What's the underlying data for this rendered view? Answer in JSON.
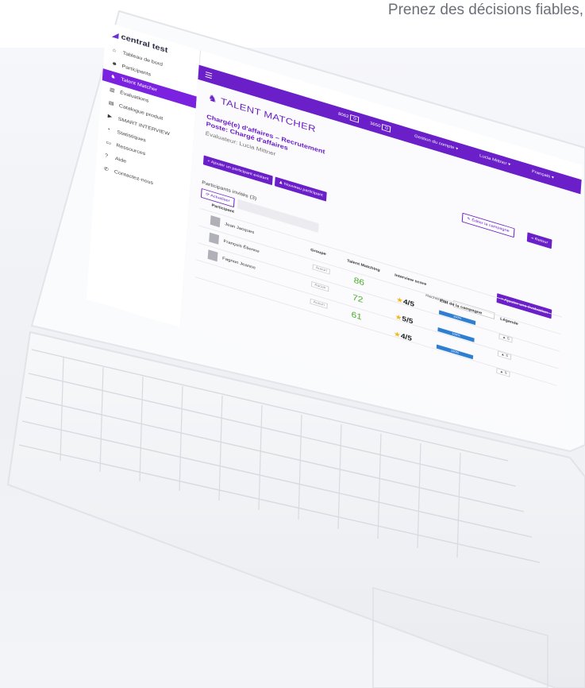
{
  "tagline": "Prenez des décisions fiables,",
  "sidebar": {
    "logo": "central test",
    "items": [
      {
        "icon": "dashboard-icon",
        "glyph": "⌂",
        "label": "Tableau de bord"
      },
      {
        "icon": "users-icon",
        "glyph": "☻",
        "label": "Participants"
      },
      {
        "icon": "talent-icon",
        "glyph": "♞",
        "label": "Talent Matcher"
      },
      {
        "icon": "chart-icon",
        "glyph": "▥",
        "label": "Évaluations"
      },
      {
        "icon": "book-icon",
        "glyph": "▤",
        "label": "Catalogue produit"
      },
      {
        "icon": "video-icon",
        "glyph": "▶",
        "label": "SMART INTERVIEW"
      },
      {
        "icon": "pie-icon",
        "glyph": "◔",
        "label": "Statistiques"
      },
      {
        "icon": "file-icon",
        "glyph": "▭",
        "label": "Ressources"
      },
      {
        "icon": "help-icon",
        "glyph": "?",
        "label": "Aide"
      },
      {
        "icon": "phone-icon",
        "glyph": "✆",
        "label": "Contactez-nous"
      }
    ]
  },
  "topbar": {
    "menu_icon": "☰",
    "credit1_value": "8062",
    "credit2_value": "3650",
    "account": "Gestion du compte ▾",
    "user": "Lucia Mittner ▾",
    "language": "Français ▾"
  },
  "main": {
    "page_title": "TALENT MATCHER",
    "job_title_line1": "Chargé(e) d'affaires – Recrutement",
    "job_title_line2": "Poste: Chargé d'affaires",
    "evaluator": "Évaluateur: Lucia Mittner",
    "edit_campaign": "Éditer la campagne",
    "back": "Retour",
    "add_existing": "+ Ajouter un participant existant",
    "new_participant": "Nouveau participant",
    "panel_title": "Participants invités (3)",
    "actualiser": "Actualiser",
    "add_evaluation": "+ Ajouter une évaluation",
    "search_label": "Rechercher :",
    "headers": {
      "participant": "Participant",
      "groupe": "Groupe",
      "talent_matching": "Talent Matching",
      "interview_score": "Interview score",
      "etat": "État de la campagne",
      "legend": "Légende"
    },
    "rows": [
      {
        "name": "Jean Jacques",
        "group": "Aucun",
        "score": "86",
        "interview": "4/5",
        "progress": "100%",
        "action": "5"
      },
      {
        "name": "François Étienne",
        "group": "Aucun",
        "score": "72",
        "interview": "5/5",
        "progress": "100%",
        "action": "5"
      },
      {
        "name": "Fagnon Jeanne",
        "group": "Aucun",
        "score": "61",
        "interview": "4/5",
        "progress": "100%",
        "action": "5"
      }
    ]
  }
}
